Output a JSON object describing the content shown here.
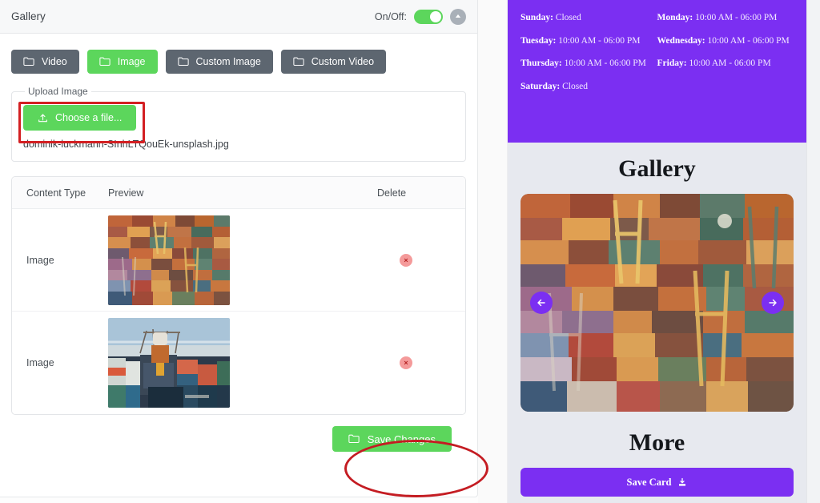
{
  "admin": {
    "header": {
      "title": "Gallery",
      "onoff_label": "On/Off:",
      "toggle_state": "on",
      "collapse_icon": "chevron-up-icon"
    },
    "type_buttons": [
      {
        "label": "Video",
        "active": false
      },
      {
        "label": "Image",
        "active": true
      },
      {
        "label": "Custom Image",
        "active": false
      },
      {
        "label": "Custom Video",
        "active": false
      }
    ],
    "upload": {
      "legend": "Upload Image",
      "choose_label": "Choose a file...",
      "filename": "dominik-luckmann-SInhLTQouEk-unsplash.jpg"
    },
    "table": {
      "headers": [
        "Content Type",
        "Preview",
        "Delete"
      ],
      "rows": [
        {
          "content_type": "Image",
          "preview": "container-yard-aerial-photo",
          "delete_label": "×"
        },
        {
          "content_type": "Image",
          "preview": "container-ship-crane-photo",
          "delete_label": "×"
        }
      ]
    },
    "save_label": "Save Changes"
  },
  "preview": {
    "hours": {
      "left": [
        {
          "day": "Sunday:",
          "time": " Closed"
        },
        {
          "day": "Tuesday:",
          "time": " 10:00 AM - 06:00 PM"
        },
        {
          "day": "Thursday:",
          "time": " 10:00 AM - 06:00 PM"
        },
        {
          "day": "Saturday:",
          "time": " Closed"
        }
      ],
      "right": [
        {
          "day": "Monday:",
          "time": " 10:00 AM - 06:00 PM"
        },
        {
          "day": "Wednesday:",
          "time": " 10:00 AM - 06:00 PM"
        },
        {
          "day": "Friday:",
          "time": " 10:00 AM - 06:00 PM"
        }
      ]
    },
    "gallery_title": "Gallery",
    "carousel": {
      "prev_icon": "arrow-left-icon",
      "next_icon": "arrow-right-icon"
    },
    "more_title": "More",
    "save_card_label": "Save Card"
  },
  "colors": {
    "green": "#5cd65c",
    "gray_button": "#5d6670",
    "purple": "#7b2ff2",
    "annotation_red": "#d31f22",
    "delete_red": "#b32020"
  }
}
